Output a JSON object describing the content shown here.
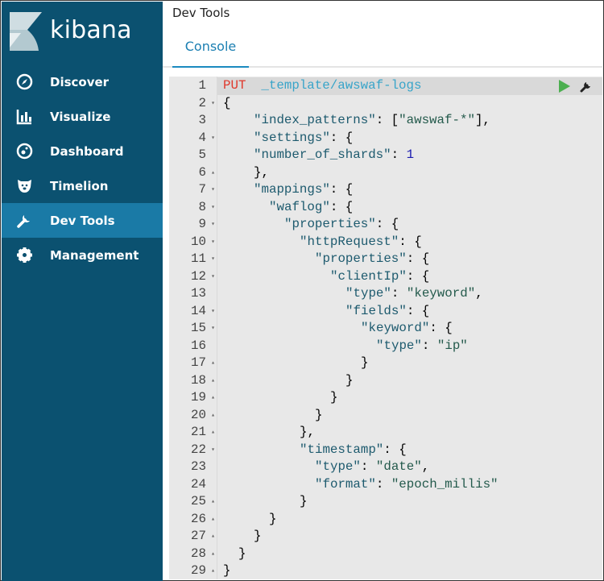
{
  "brand": "kibana",
  "nav": [
    {
      "label": "Discover",
      "icon": "compass-icon"
    },
    {
      "label": "Visualize",
      "icon": "bar-chart-icon"
    },
    {
      "label": "Dashboard",
      "icon": "dashboard-icon"
    },
    {
      "label": "Timelion",
      "icon": "bear-icon"
    },
    {
      "label": "Dev Tools",
      "icon": "wrench-icon",
      "active": true
    },
    {
      "label": "Management",
      "icon": "gear-icon"
    }
  ],
  "page_title": "Dev Tools",
  "tabs": [
    {
      "label": "Console"
    }
  ],
  "colors": {
    "sidebar": "#0b5170",
    "active": "#1a7aa6",
    "method": "#e0382b",
    "url": "#37a4c9",
    "run": "#4caf50"
  },
  "editor": {
    "lines": [
      {
        "n": "1",
        "f": "",
        "i": 0,
        "t": [
          {
            "c": "m",
            "t": "PUT"
          },
          {
            "c": "p",
            "t": "  "
          },
          {
            "c": "u",
            "t": "_template/awswaf-logs"
          }
        ]
      },
      {
        "n": "2",
        "f": "▾",
        "i": 0,
        "t": [
          {
            "c": "p",
            "t": "{"
          }
        ]
      },
      {
        "n": "3",
        "f": "",
        "i": 4,
        "t": [
          {
            "c": "k",
            "t": "\"index_patterns\""
          },
          {
            "c": "p",
            "t": ": ["
          },
          {
            "c": "s",
            "t": "\"awswaf-*\""
          },
          {
            "c": "p",
            "t": "],"
          }
        ]
      },
      {
        "n": "4",
        "f": "▾",
        "i": 4,
        "t": [
          {
            "c": "k",
            "t": "\"settings\""
          },
          {
            "c": "p",
            "t": ": {"
          }
        ]
      },
      {
        "n": "5",
        "f": "",
        "i": 4,
        "t": [
          {
            "c": "k",
            "t": "\"number_of_shards\""
          },
          {
            "c": "p",
            "t": ": "
          },
          {
            "c": "n",
            "t": "1"
          }
        ]
      },
      {
        "n": "6",
        "f": "▴",
        "i": 4,
        "t": [
          {
            "c": "p",
            "t": "},"
          }
        ]
      },
      {
        "n": "7",
        "f": "▾",
        "i": 4,
        "t": [
          {
            "c": "k",
            "t": "\"mappings\""
          },
          {
            "c": "p",
            "t": ": {"
          }
        ]
      },
      {
        "n": "8",
        "f": "▾",
        "i": 6,
        "t": [
          {
            "c": "k",
            "t": "\"waflog\""
          },
          {
            "c": "p",
            "t": ": {"
          }
        ]
      },
      {
        "n": "9",
        "f": "▾",
        "i": 8,
        "t": [
          {
            "c": "k",
            "t": "\"properties\""
          },
          {
            "c": "p",
            "t": ": {"
          }
        ]
      },
      {
        "n": "10",
        "f": "▾",
        "i": 10,
        "t": [
          {
            "c": "k",
            "t": "\"httpRequest\""
          },
          {
            "c": "p",
            "t": ": {"
          }
        ]
      },
      {
        "n": "11",
        "f": "▾",
        "i": 12,
        "t": [
          {
            "c": "k",
            "t": "\"properties\""
          },
          {
            "c": "p",
            "t": ": {"
          }
        ]
      },
      {
        "n": "12",
        "f": "▾",
        "i": 14,
        "t": [
          {
            "c": "k",
            "t": "\"clientIp\""
          },
          {
            "c": "p",
            "t": ": {"
          }
        ]
      },
      {
        "n": "13",
        "f": "",
        "i": 16,
        "t": [
          {
            "c": "k",
            "t": "\"type\""
          },
          {
            "c": "p",
            "t": ": "
          },
          {
            "c": "s",
            "t": "\"keyword\""
          },
          {
            "c": "p",
            "t": ","
          }
        ]
      },
      {
        "n": "14",
        "f": "▾",
        "i": 16,
        "t": [
          {
            "c": "k",
            "t": "\"fields\""
          },
          {
            "c": "p",
            "t": ": {"
          }
        ]
      },
      {
        "n": "15",
        "f": "▾",
        "i": 18,
        "t": [
          {
            "c": "k",
            "t": "\"keyword\""
          },
          {
            "c": "p",
            "t": ": {"
          }
        ]
      },
      {
        "n": "16",
        "f": "",
        "i": 20,
        "t": [
          {
            "c": "k",
            "t": "\"type\""
          },
          {
            "c": "p",
            "t": ": "
          },
          {
            "c": "s",
            "t": "\"ip\""
          }
        ]
      },
      {
        "n": "17",
        "f": "▴",
        "i": 18,
        "t": [
          {
            "c": "p",
            "t": "}"
          }
        ]
      },
      {
        "n": "18",
        "f": "▴",
        "i": 16,
        "t": [
          {
            "c": "p",
            "t": "}"
          }
        ]
      },
      {
        "n": "19",
        "f": "▴",
        "i": 14,
        "t": [
          {
            "c": "p",
            "t": "}"
          }
        ]
      },
      {
        "n": "20",
        "f": "▴",
        "i": 12,
        "t": [
          {
            "c": "p",
            "t": "}"
          }
        ]
      },
      {
        "n": "21",
        "f": "▴",
        "i": 10,
        "t": [
          {
            "c": "p",
            "t": "},"
          }
        ]
      },
      {
        "n": "22",
        "f": "▾",
        "i": 10,
        "t": [
          {
            "c": "k",
            "t": "\"timestamp\""
          },
          {
            "c": "p",
            "t": ": {"
          }
        ]
      },
      {
        "n": "23",
        "f": "",
        "i": 12,
        "t": [
          {
            "c": "k",
            "t": "\"type\""
          },
          {
            "c": "p",
            "t": ": "
          },
          {
            "c": "s",
            "t": "\"date\""
          },
          {
            "c": "p",
            "t": ","
          }
        ]
      },
      {
        "n": "24",
        "f": "",
        "i": 12,
        "t": [
          {
            "c": "k",
            "t": "\"format\""
          },
          {
            "c": "p",
            "t": ": "
          },
          {
            "c": "s",
            "t": "\"epoch_millis\""
          }
        ]
      },
      {
        "n": "25",
        "f": "▴",
        "i": 10,
        "t": [
          {
            "c": "p",
            "t": "}"
          }
        ]
      },
      {
        "n": "26",
        "f": "▴",
        "i": 6,
        "t": [
          {
            "c": "p",
            "t": "}"
          }
        ]
      },
      {
        "n": "27",
        "f": "▴",
        "i": 4,
        "t": [
          {
            "c": "p",
            "t": "}"
          }
        ]
      },
      {
        "n": "28",
        "f": "▴",
        "i": 2,
        "t": [
          {
            "c": "p",
            "t": "}"
          }
        ]
      },
      {
        "n": "29",
        "f": "▴",
        "i": 0,
        "t": [
          {
            "c": "p",
            "t": "}"
          }
        ]
      }
    ]
  }
}
